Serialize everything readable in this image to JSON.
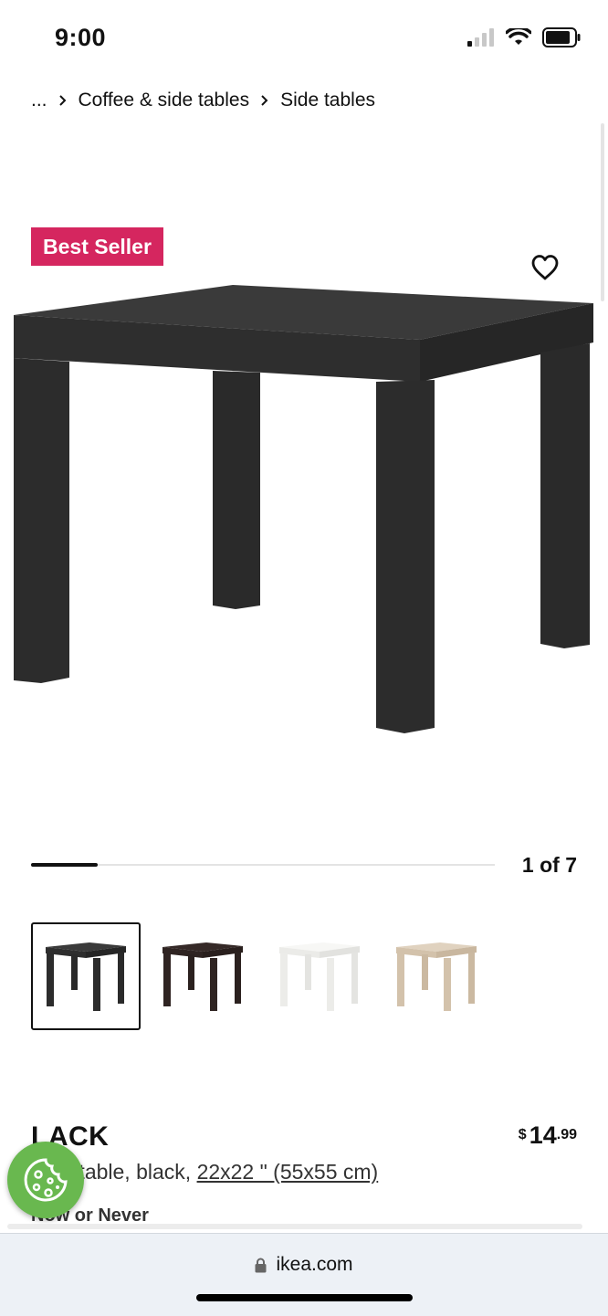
{
  "status_bar": {
    "time": "9:00",
    "cellular_icon": "cellular-signal-icon",
    "wifi_icon": "wifi-icon",
    "battery_icon": "battery-icon"
  },
  "breadcrumb": {
    "ellipsis": "...",
    "items": [
      "Coffee & side tables",
      "Side tables"
    ]
  },
  "product": {
    "badge": "Best Seller",
    "name": "LACK",
    "description_prefix": "Side table, black, ",
    "dimensions": "22x22 \" (55x55 cm)",
    "tag": "Now or Never",
    "price": {
      "currency": "$",
      "integer": "14",
      "decimal": ".99"
    },
    "favorite_icon": "heart-outline-icon"
  },
  "gallery": {
    "counter": "1 of 7",
    "current": 1,
    "total": 7,
    "thumbnails": [
      {
        "name": "black",
        "color": "#2a2a2a",
        "active": true
      },
      {
        "name": "black-brown",
        "color": "#2f2422",
        "active": false
      },
      {
        "name": "white",
        "color": "#f2f2f0",
        "active": false
      },
      {
        "name": "white-stained-oak",
        "color": "#d8c8b3",
        "active": false
      }
    ]
  },
  "colors": {
    "badge": "#d5265f",
    "cookie": "#69b84f"
  },
  "browser": {
    "url": "ikea.com",
    "lock_icon": "lock-icon"
  }
}
